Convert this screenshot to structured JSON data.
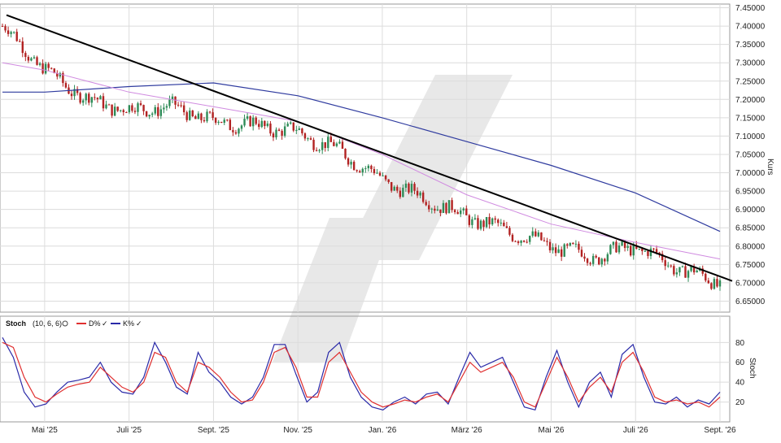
{
  "colors": {
    "background": "#ffffff",
    "grid": "#dcdcdc",
    "up_candle": "#2e8b57",
    "down_candle": "#b22222",
    "trendline": "#000000",
    "ma_long": "#2f3b9f",
    "ma_short": "#d08be0",
    "stoch_d": "#e03030",
    "stoch_k": "#2a2aa8",
    "watermark": "#e6e6e6"
  },
  "chart_data": [
    {
      "type": "candlestick",
      "ylabel": "Kurs",
      "ylim": [
        6.62,
        7.46
      ],
      "y_ticks": [
        "7.45000",
        "7.40000",
        "7.35000",
        "7.30000",
        "7.25000",
        "7.20000",
        "7.15000",
        "7.10000",
        "7.05000",
        "7.00000",
        "6.95000",
        "6.90000",
        "6.85000",
        "6.80000",
        "6.75000",
        "6.70000",
        "6.65000"
      ],
      "x_ticks": [
        "Mai '25",
        "Juli '25",
        "Sept. '25",
        "Nov. '25",
        "Jan. '26",
        "März '26",
        "Mai '26",
        "Juli '26",
        "Sept. '26"
      ],
      "grid": true,
      "price_path": {
        "x": [
          "Apr '25",
          "Mai '25",
          "Juni '25",
          "Juli '25",
          "Aug. '25",
          "Sept. '25",
          "Okt. '25",
          "Nov. '25",
          "Dez. '25",
          "Jan. '26",
          "Feb. '26",
          "März '26",
          "Apr. '26",
          "Mai '26",
          "Juni '26",
          "Juli '26",
          "Aug. '26",
          "Sept. '26"
        ],
        "close": [
          7.4,
          7.28,
          7.2,
          7.17,
          7.18,
          7.14,
          7.13,
          7.11,
          7.06,
          6.98,
          6.93,
          6.88,
          6.84,
          6.8,
          6.77,
          6.8,
          6.74,
          6.7
        ]
      },
      "series": [
        {
          "kind": "trendline",
          "points": [
            [
              "Apr '25",
              7.43
            ],
            [
              "Sept. '26",
              6.705
            ]
          ]
        },
        {
          "kind": "moving_average_long",
          "x": [
            "Apr '25",
            "Mai '25",
            "Juli '25",
            "Sept. '25",
            "Nov. '25",
            "Jan. '26",
            "März '26",
            "Mai '26",
            "Juli '26",
            "Sept. '26"
          ],
          "values": [
            7.22,
            7.22,
            7.235,
            7.245,
            7.21,
            7.15,
            7.085,
            7.02,
            6.945,
            6.84
          ]
        },
        {
          "kind": "moving_average_short",
          "x": [
            "Apr '25",
            "Mai '25",
            "Juli '25",
            "Sept. '25",
            "Nov. '25",
            "Jan. '26",
            "März '26",
            "Mai '26",
            "Juli '26",
            "Sept. '26"
          ],
          "values": [
            7.3,
            7.28,
            7.22,
            7.18,
            7.14,
            7.05,
            6.94,
            6.86,
            6.81,
            6.765
          ]
        }
      ]
    },
    {
      "type": "line",
      "title": "Stoch",
      "params": "(10, 6, 6)",
      "ylabel": "Stoch",
      "ylim": [
        0,
        95
      ],
      "y_ticks": [
        "80",
        "60",
        "40",
        "20"
      ],
      "grid": true,
      "legend_placement": "top-left",
      "series": [
        {
          "name": "D%",
          "values": [
            80,
            75,
            45,
            25,
            20,
            28,
            35,
            38,
            40,
            55,
            45,
            35,
            30,
            40,
            70,
            65,
            40,
            30,
            60,
            55,
            45,
            30,
            20,
            22,
            40,
            70,
            75,
            55,
            25,
            25,
            60,
            70,
            50,
            30,
            20,
            15,
            18,
            22,
            20,
            25,
            28,
            20,
            40,
            60,
            50,
            55,
            60,
            45,
            20,
            15,
            40,
            65,
            45,
            20,
            35,
            45,
            30,
            60,
            70,
            50,
            25,
            20,
            22,
            18,
            20,
            15,
            25
          ]
        },
        {
          "name": "K%",
          "values": [
            85,
            65,
            30,
            15,
            18,
            30,
            40,
            42,
            45,
            60,
            40,
            30,
            28,
            45,
            80,
            60,
            35,
            28,
            70,
            50,
            40,
            25,
            18,
            25,
            45,
            78,
            78,
            48,
            20,
            30,
            70,
            80,
            45,
            25,
            15,
            12,
            20,
            25,
            18,
            28,
            30,
            18,
            45,
            70,
            55,
            60,
            65,
            40,
            15,
            12,
            45,
            72,
            40,
            15,
            40,
            50,
            25,
            68,
            78,
            45,
            20,
            18,
            25,
            15,
            22,
            18,
            30
          ]
        }
      ],
      "x_ticks": [
        "Mai '25",
        "Juli '25",
        "Sept. '25",
        "Nov. '25",
        "Jan. '26",
        "März '26",
        "Mai '26",
        "Juli '26",
        "Sept. '26"
      ]
    }
  ]
}
